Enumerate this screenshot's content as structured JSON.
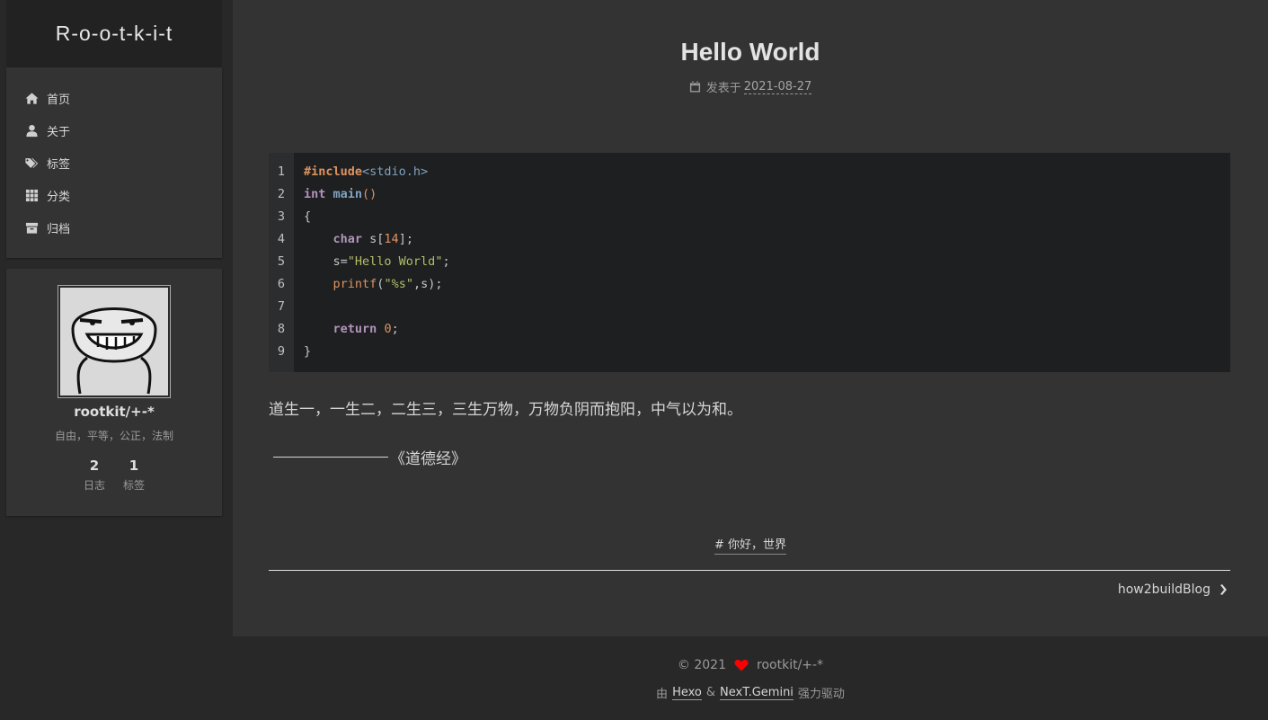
{
  "site": {
    "title": "R-o-o-t-k-i-t"
  },
  "menu": {
    "items": [
      {
        "label": "首页",
        "icon": "home-icon"
      },
      {
        "label": "关于",
        "icon": "user-icon"
      },
      {
        "label": "标签",
        "icon": "tags-icon"
      },
      {
        "label": "分类",
        "icon": "th-icon"
      },
      {
        "label": "归档",
        "icon": "archive-icon"
      }
    ]
  },
  "author": {
    "name": "rootkit/+-*",
    "description": "自由，平等，公正，法制",
    "stats": [
      {
        "count": "2",
        "label": "日志"
      },
      {
        "count": "1",
        "label": "标签"
      }
    ]
  },
  "post": {
    "title": "Hello World",
    "meta_label": "发表于",
    "date": "2021-08-27",
    "code_line_numbers": [
      "1",
      "2",
      "3",
      "4",
      "5",
      "6",
      "7",
      "8",
      "9"
    ],
    "quote": "道生一，一生二，二生三，三生万物，万物负阴而抱阳，中气以为和。",
    "source": "《道德经》",
    "tag": "# 你好，世界",
    "next": "how2buildBlog"
  },
  "footer": {
    "copyright": "© 2021",
    "owner": "rootkit/+-*",
    "powered_prefix": "由",
    "hexo": "Hexo",
    "amp": "&",
    "theme": "NexT.Gemini",
    "powered_suffix": "强力驱动"
  },
  "colors": {
    "heart": "#ff0000",
    "background": "#282828",
    "panel": "#333333",
    "code_bg": "#1d1f21"
  }
}
